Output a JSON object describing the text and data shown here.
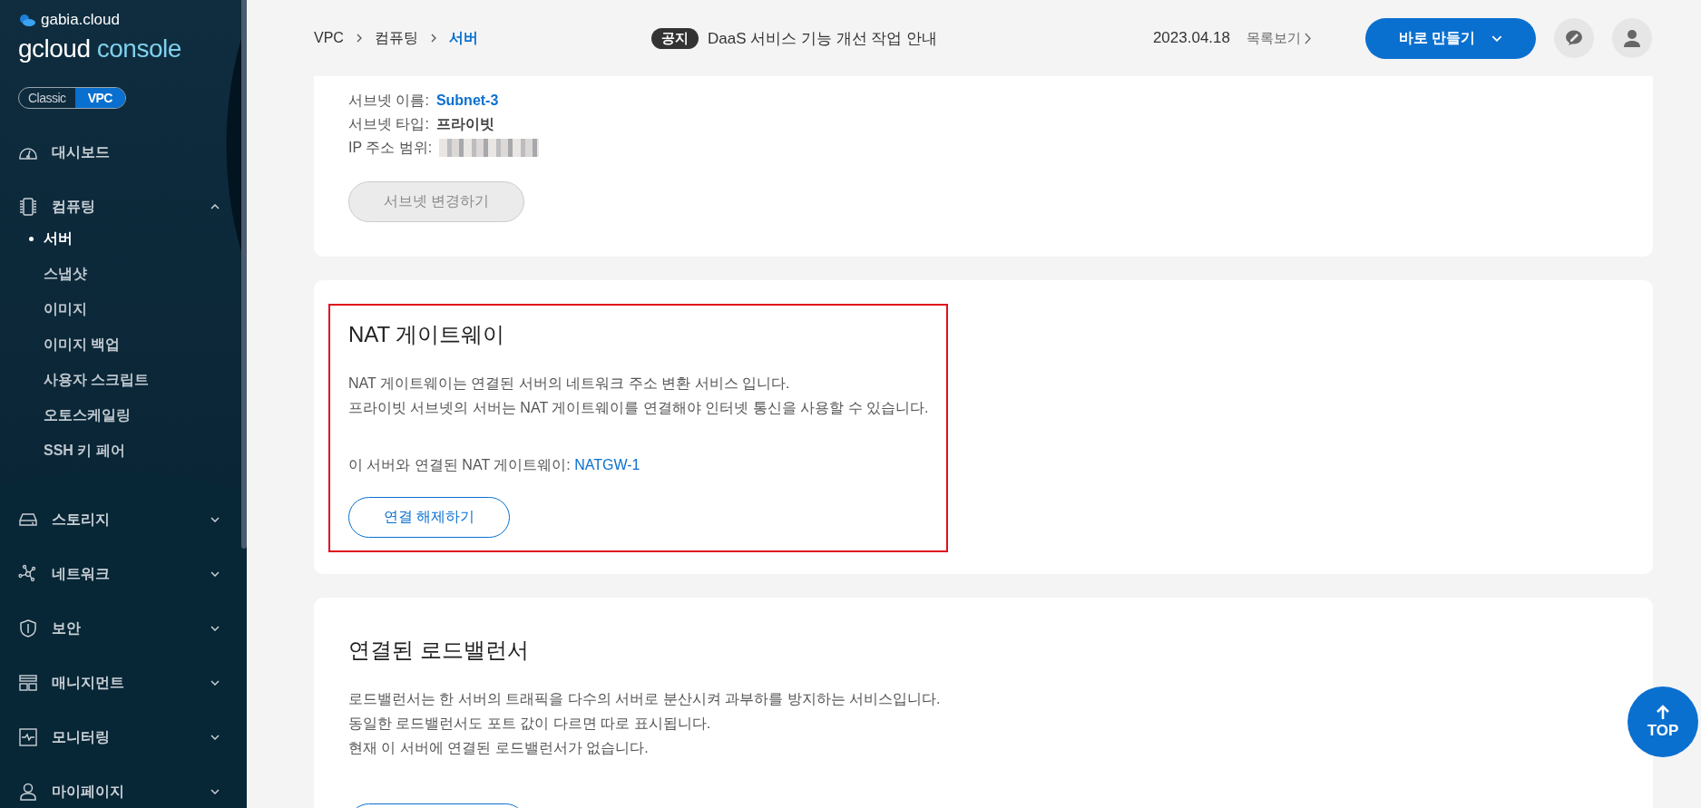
{
  "sidebar": {
    "brand": "gabia.cloud",
    "product": {
      "name": "gcloud",
      "suffix": "console"
    },
    "mode_tabs": [
      {
        "label": "Classic",
        "selected": false
      },
      {
        "label": "VPC",
        "selected": true
      }
    ],
    "nav": [
      {
        "label": "대시보드"
      },
      {
        "label": "컴퓨팅",
        "expanded": true,
        "children": [
          {
            "label": "서버",
            "selected": true
          },
          {
            "label": "스냅샷",
            "selected": false
          },
          {
            "label": "이미지",
            "selected": false
          },
          {
            "label": "이미지 백업",
            "selected": false
          },
          {
            "label": "사용자 스크립트",
            "selected": false
          },
          {
            "label": "오토스케일링",
            "selected": false
          },
          {
            "label": "SSH 키 페어",
            "selected": false
          }
        ]
      },
      {
        "label": "스토리지",
        "expanded": false
      },
      {
        "label": "네트워크",
        "expanded": false
      },
      {
        "label": "보안",
        "expanded": false
      },
      {
        "label": "매니지먼트",
        "expanded": false
      },
      {
        "label": "모니터링",
        "expanded": false
      },
      {
        "label": "마이페이지",
        "expanded": false
      }
    ]
  },
  "header": {
    "breadcrumb": [
      "VPC",
      "컴퓨팅",
      "서버"
    ],
    "notice": {
      "badge": "공지",
      "title": "DaaS 서비스 기능 개선 작업 안내",
      "date": "2023.04.18",
      "more_link": "목록보기"
    },
    "create_button": "바로 만들기"
  },
  "cards": [
    {
      "kind": "subnet",
      "fields": [
        {
          "label": "서브넷 이름:",
          "value": "Subnet-3",
          "kind": "link"
        },
        {
          "label": "서브넷 타입:",
          "value": "프라이빗",
          "kind": "bold"
        },
        {
          "label": "IP 주소 범위:",
          "kind": "redacted"
        }
      ],
      "button": {
        "label": "서브넷 변경하기",
        "disabled": true
      }
    },
    {
      "kind": "nat",
      "highlighted": true,
      "title": "NAT 게이트웨이",
      "description": [
        "NAT 게이트웨이는 연결된 서버의 네트워크 주소 변환 서비스 입니다.",
        "프라이빗 서브넷의 서버는 NAT 게이트웨이를 연결해야 인터넷 통신을 사용할 수 있습니다."
      ],
      "connected": {
        "label": "이 서버와 연결된 NAT 게이트웨이:",
        "value": "NATGW-1"
      },
      "button": {
        "label": "연결 해제하기",
        "disabled": false
      }
    },
    {
      "kind": "load_balancer",
      "highlighted": false,
      "title": "연결된 로드밸런서",
      "description": [
        "로드밸런서는 한 서버의 트래픽을 다수의 서버로 분산시켜 과부하를 방지하는 서비스입니다.",
        "동일한 로드밸런서도 포트 값이 다르면 따로 표시됩니다.",
        "현재 이 서버에 연결된 로드밸런서가 없습니다."
      ],
      "button": {
        "disabled": false
      }
    }
  ],
  "top_button": "TOP"
}
